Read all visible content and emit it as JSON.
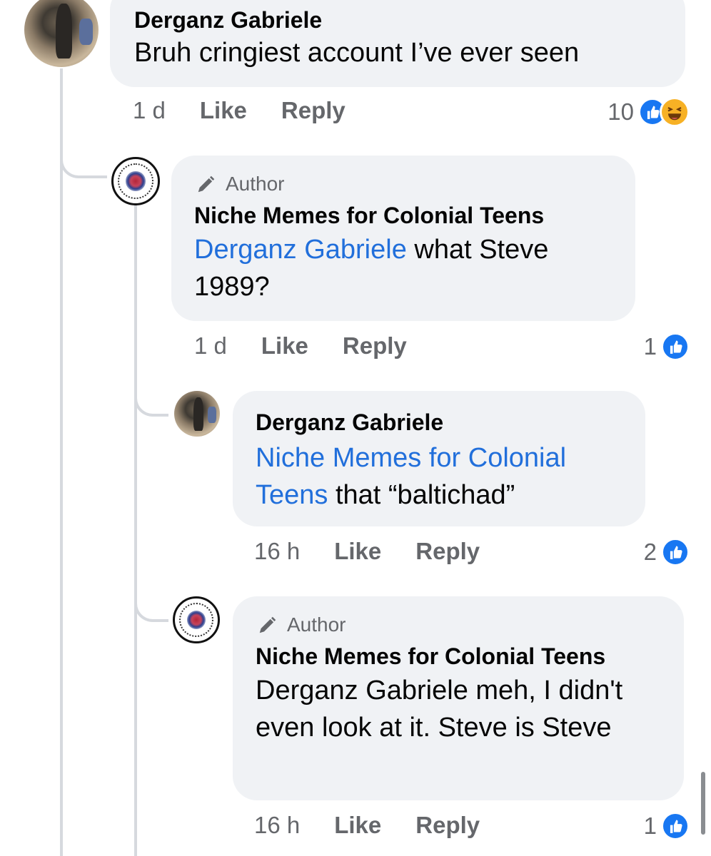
{
  "comments": [
    {
      "author": "Derganz Gabriele",
      "is_author": false,
      "segments": [
        {
          "text": "Bruh cringiest account I’ve ever seen",
          "mention": false
        }
      ],
      "time": "1 d",
      "like_label": "Like",
      "reply_label": "Reply",
      "reaction_count": "10",
      "reactions": [
        "like-icon",
        "haha-icon"
      ]
    },
    {
      "author": "Niche Memes for Colonial Teens",
      "is_author": true,
      "author_badge": "Author",
      "segments": [
        {
          "text": "Derganz Gabriele",
          "mention": true
        },
        {
          "text": " what Steve 1989?",
          "mention": false
        }
      ],
      "time": "1 d",
      "like_label": "Like",
      "reply_label": "Reply",
      "reaction_count": "1",
      "reactions": [
        "like-icon"
      ]
    },
    {
      "author": "Derganz Gabriele",
      "is_author": false,
      "segments": [
        {
          "text": "Niche Memes for Colonial Teens",
          "mention": true
        },
        {
          "text": " that “baltichad”",
          "mention": false
        }
      ],
      "time": "16 h",
      "like_label": "Like",
      "reply_label": "Reply",
      "reaction_count": "2",
      "reactions": [
        "like-icon"
      ]
    },
    {
      "author": "Niche Memes for Colonial Teens",
      "is_author": true,
      "author_badge": "Author",
      "segments": [
        {
          "text": "Derganz Gabriele meh, I didn't even look at it. Steve is Steve",
          "mention": false
        }
      ],
      "time": "16 h",
      "like_label": "Like",
      "reply_label": "Reply",
      "reaction_count": "1",
      "reactions": [
        "like-icon"
      ]
    }
  ],
  "colors": {
    "mention": "#216fdb",
    "like": "#1877f2",
    "bubble": "#f0f2f5",
    "meta": "#65676b"
  }
}
